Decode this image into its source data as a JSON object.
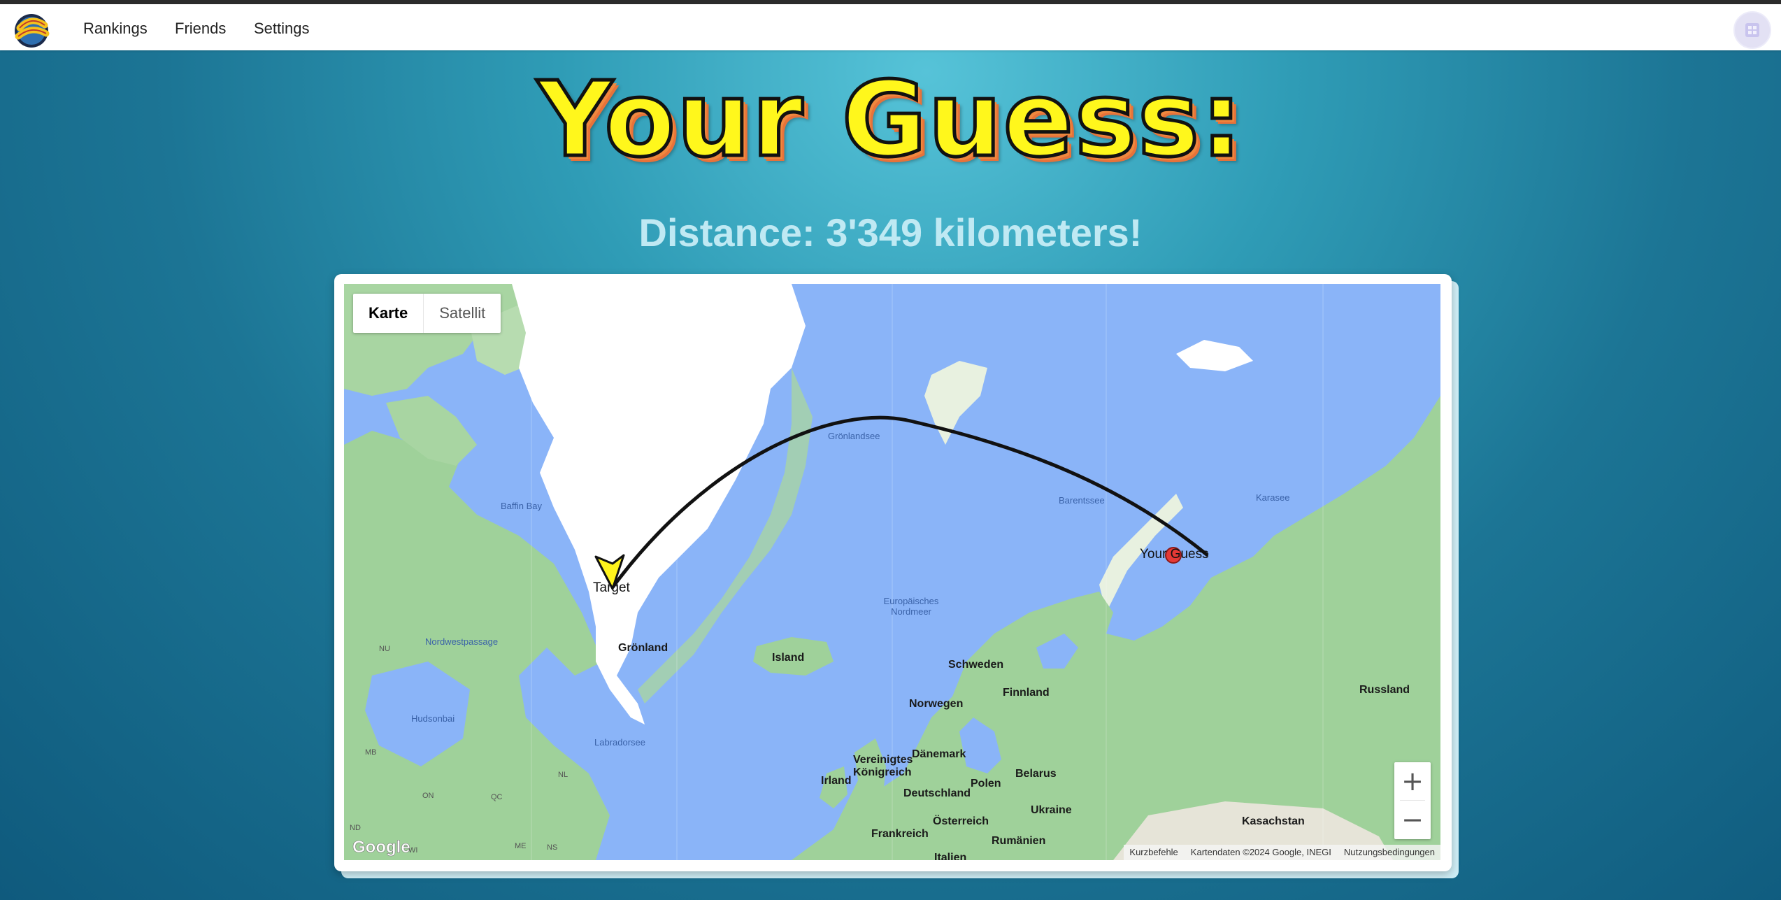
{
  "nav": {
    "links": [
      "Rankings",
      "Friends",
      "Settings"
    ]
  },
  "header": {
    "title": "Your Guess:",
    "distance": "Distance: 3'349 kilometers!"
  },
  "map": {
    "map_type": {
      "map": "Karte",
      "satellite": "Satellit"
    },
    "zoom": {
      "in": "+",
      "out": "−"
    },
    "markers": {
      "target": "Target",
      "guess": "Your Guess"
    },
    "labels": {
      "groenland": "Grönland",
      "island": "Island",
      "schweden": "Schweden",
      "finnland": "Finnland",
      "norwegen": "Norwegen",
      "russland": "Russland",
      "vereinigtes": "Vereinigtes Königreich",
      "daenemark": "Dänemark",
      "irland": "Irland",
      "deutschland": "Deutschland",
      "polen": "Polen",
      "belarus": "Belarus",
      "ukraine": "Ukraine",
      "oesterreich": "Österreich",
      "frankreich": "Frankreich",
      "rumaenien": "Rumänien",
      "italien": "Italien",
      "kasachstan": "Kasachstan",
      "baffin_bay": "Baffin Bay",
      "nordwestpassage": "Nordwestpassage",
      "hudsonbai": "Hudsonbai",
      "labradorsee": "Labradorsee",
      "groenlandsee": "Grönlandsee",
      "barentssee": "Barentssee",
      "karasee": "Karasee",
      "europaeisches_nordmeer": "Europäisches Nordmeer",
      "nu": "NU",
      "mb": "MB",
      "on": "ON",
      "qc": "QC",
      "nl": "NL",
      "nd": "ND",
      "me": "ME",
      "ns": "NS",
      "wi": "WI"
    },
    "attribution": {
      "shortcuts": "Kurzbefehle",
      "data": "Kartendaten ©2024 Google, INEGI",
      "terms": "Nutzungsbedingungen"
    },
    "google_logo": "Google"
  },
  "colors": {
    "title_fill": "#fff71c",
    "title_shadow": "#f0883e",
    "distance_text": "#bfe9f3",
    "water": "#8ab4f8",
    "land": "#9fd19a",
    "ice": "#ffffff",
    "guess_marker": "#e53935",
    "target_marker": "#fff31c"
  },
  "icons": {
    "logo": "map-mystery-logo",
    "avatar": "user-avatar-icon"
  }
}
